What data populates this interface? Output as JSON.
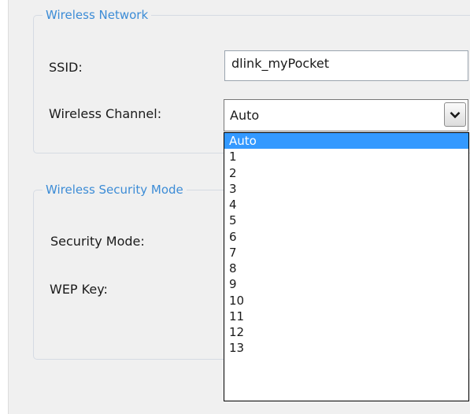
{
  "wireless_network": {
    "legend": "Wireless Network",
    "ssid_label": "SSID:",
    "ssid_value": "dlink_myPocket",
    "channel_label": "Wireless Channel:",
    "channel_value": "Auto",
    "channel_options": [
      "Auto",
      "1",
      "2",
      "3",
      "4",
      "5",
      "6",
      "7",
      "8",
      "9",
      "10",
      "11",
      "12",
      "13"
    ],
    "channel_selected_index": 0,
    "dropdown_icon": "chevron-down-icon"
  },
  "security": {
    "legend": "Wireless Security Mode",
    "security_mode_label": "Security Mode:",
    "wep_key_label": "WEP Key:"
  },
  "colors": {
    "legend_text": "#3c8cd6",
    "panel_background": "#f0f0f0",
    "selected_option_background": "#3399ff"
  }
}
